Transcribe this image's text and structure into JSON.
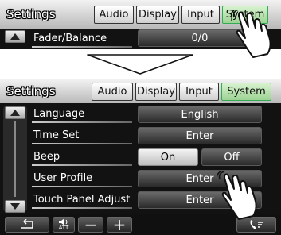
{
  "top_screen": {
    "title": "Settings",
    "tabs": [
      {
        "label": "Audio",
        "active": false
      },
      {
        "label": "Display",
        "active": false
      },
      {
        "label": "Input",
        "active": false
      },
      {
        "label": "System",
        "active": true
      }
    ],
    "row": {
      "label": "Fader/Balance",
      "value": "0/0"
    }
  },
  "bottom_screen": {
    "title": "Settings",
    "tabs": [
      {
        "label": "Audio",
        "active": false
      },
      {
        "label": "Display",
        "active": false
      },
      {
        "label": "Input",
        "active": false
      },
      {
        "label": "System",
        "active": true
      }
    ],
    "rows": [
      {
        "label": "Language",
        "value": "English"
      },
      {
        "label": "Time Set",
        "value": "Enter"
      },
      {
        "label": "Beep",
        "options": [
          "On",
          "Off"
        ],
        "selected": "On"
      },
      {
        "label": "User Profile",
        "value": "Enter"
      },
      {
        "label": "Touch Panel Adjust",
        "value": "Enter"
      }
    ],
    "bottom_bar": {
      "att_label": "ATT",
      "minus": "−",
      "plus": "+"
    }
  },
  "colors": {
    "active_tab": "#9dd393",
    "screen_bg": "#121212"
  },
  "icons": [
    "finger-tap-icon",
    "down-arrow-icon",
    "scroll-up-icon",
    "scroll-down-icon",
    "back-icon",
    "speaker-icon",
    "phone-icon"
  ]
}
